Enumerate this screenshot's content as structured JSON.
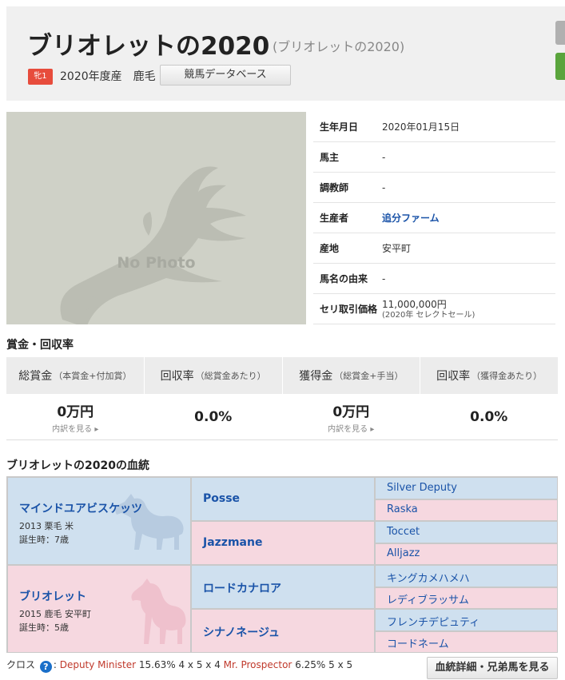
{
  "header": {
    "title": "ブリオレットの2020",
    "subtitle": "(ブリオレットの2020)",
    "badge": "牝1",
    "meta": "2020年度産　鹿毛",
    "db_button": "競馬データベース"
  },
  "photo": {
    "placeholder": "No Photo"
  },
  "info": [
    {
      "key": "生年月日",
      "value": "2020年01月15日"
    },
    {
      "key": "馬主",
      "value": "-"
    },
    {
      "key": "調教師",
      "value": "-"
    },
    {
      "key": "生産者",
      "value": "追分ファーム"
    },
    {
      "key": "産地",
      "value": "安平町"
    },
    {
      "key": "馬名の由来",
      "value": "-"
    },
    {
      "key": "セリ取引価格",
      "value": "11,000,000円",
      "note": "(2020年 セレクトセール)"
    }
  ],
  "prize": {
    "section_title": "賞金・回収率",
    "headers": [
      {
        "main": "総賞金",
        "sub": "（本賞金+付加賞）"
      },
      {
        "main": "回収率",
        "sub": "（総賞金あたり）"
      },
      {
        "main": "獲得金",
        "sub": "（総賞金+手当）"
      },
      {
        "main": "回収率",
        "sub": "（獲得金あたり）"
      }
    ],
    "values": [
      "0万円",
      "0.0%",
      "0万円",
      "0.0%"
    ],
    "breakdown_link": "内訳を見る ▸"
  },
  "pedigree": {
    "section_title": "ブリオレットの2020の血統",
    "sire": {
      "name": "マインドユアビスケッツ",
      "line1": "2013 栗毛 米",
      "line2": "誕生時：7歳"
    },
    "dam": {
      "name": "ブリオレット",
      "line1": "2015 鹿毛 安平町",
      "line2": "誕生時：5歳"
    },
    "gen2": [
      "Posse",
      "Jazzmane",
      "ロードカナロア",
      "シナノネージュ"
    ],
    "gen3": [
      "Silver Deputy",
      "Raska",
      "Toccet",
      "Alljazz",
      "キングカメハメハ",
      "レディブラッサム",
      "フレンチデピュティ",
      "コードネーム"
    ]
  },
  "cross": {
    "label": "クロス",
    "help": "?",
    "h1": "Deputy Minister",
    "v1": "15.63% 4 x 5 x 4",
    "h2": "Mr. Prospector",
    "v2": "6.25% 5 x 5"
  },
  "detail_button": "血統詳細・兄弟馬を見る"
}
